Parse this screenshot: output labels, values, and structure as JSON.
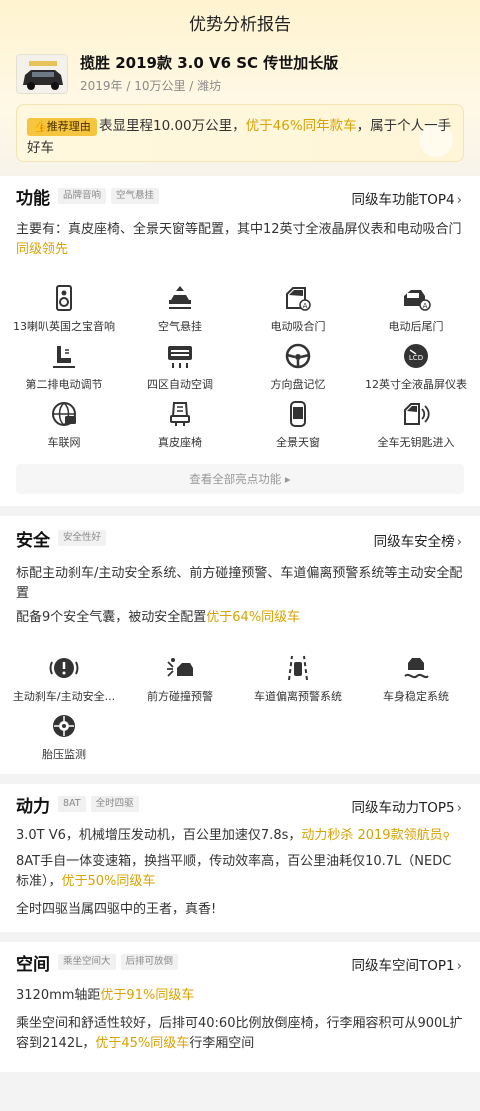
{
  "header": {
    "title": "优势分析报告"
  },
  "car": {
    "name": "揽胜 2019款 3.0 V6 SC 传世加长版",
    "meta": "2019年 / 10万公里 / 潍坊"
  },
  "reason": {
    "tag": "推荐理由",
    "text_a": "表显里程10.00万公里，",
    "highlight": "优于46%同年款车",
    "text_b": "，属于个人一手好车"
  },
  "features": {
    "title": "功能",
    "chips": [
      "品牌音响",
      "空气悬挂"
    ],
    "link": "同级车功能TOP4",
    "desc_a": "主要有：真皮座椅、全景天窗等配置，其中12英寸全液晶屏仪表和电动吸合门",
    "desc_hl": "同级领先",
    "items": [
      {
        "label": "13喇叭英国之宝音响",
        "icon": "speaker-icon"
      },
      {
        "label": "空气悬挂",
        "icon": "air-suspension-icon"
      },
      {
        "label": "电动吸合门",
        "icon": "soft-close-door-icon"
      },
      {
        "label": "电动后尾门",
        "icon": "power-tailgate-icon"
      },
      {
        "label": "第二排电动调节",
        "icon": "power-seat-icon"
      },
      {
        "label": "四区自动空调",
        "icon": "climate-control-icon"
      },
      {
        "label": "方向盘记忆",
        "icon": "steering-wheel-icon"
      },
      {
        "label": "12英寸全液晶屏仪表",
        "icon": "lcd-dashboard-icon"
      },
      {
        "label": "车联网",
        "icon": "connected-car-icon"
      },
      {
        "label": "真皮座椅",
        "icon": "leather-seat-icon"
      },
      {
        "label": "全景天窗",
        "icon": "panoramic-sunroof-icon"
      },
      {
        "label": "全车无钥匙进入",
        "icon": "keyless-entry-icon"
      }
    ],
    "more": "查看全部亮点功能 ▸"
  },
  "safety": {
    "title": "安全",
    "chips": [
      "安全性好"
    ],
    "link": "同级车安全榜",
    "desc1": "标配主动刹车/主动安全系统、前方碰撞预警、车道偏离预警系统等主动安全配置",
    "desc2_a": "配备9个安全气囊，被动安全配置",
    "desc2_hl": "优于64%同级车",
    "items": [
      {
        "label": "主动刹车/主动安全...",
        "icon": "active-brake-icon"
      },
      {
        "label": "前方碰撞预警",
        "icon": "collision-warning-icon"
      },
      {
        "label": "车道偏离预警系统",
        "icon": "lane-departure-icon"
      },
      {
        "label": "车身稳定系统",
        "icon": "stability-control-icon"
      },
      {
        "label": "胎压监测",
        "icon": "tire-pressure-icon"
      }
    ]
  },
  "power": {
    "title": "动力",
    "chips": [
      "8AT",
      "全时四驱"
    ],
    "link": "同级车动力TOP5",
    "desc1_a": "3.0T V6，机械增压发动机，百公里加速仅7.8s，",
    "desc1_hl": "动力秒杀 2019款领航员",
    "desc2_a": "8AT手自一体变速箱，换挡平顺，传动效率高，百公里油耗仅10.7L（NEDC标准），",
    "desc2_hl": "优于50%同级车",
    "desc3": "全时四驱当属四驱中的王者，真香!"
  },
  "space": {
    "title": "空间",
    "chips": [
      "乘坐空间大",
      "后排可放倒"
    ],
    "link": "同级车空间TOP1",
    "desc1_a": "3120mm轴距",
    "desc1_hl": "优于91%同级车",
    "desc2_a": "乘坐空间和舒适性较好，后排可40:60比例放倒座椅，行李厢容积可从900L扩容到2142L，",
    "desc2_hl": "优于45%同级车",
    "desc2_b": "行李厢空间"
  },
  "colors": {
    "accent": "#d8a200",
    "tag": "#f6c53f",
    "hero": "#fff3cf"
  }
}
